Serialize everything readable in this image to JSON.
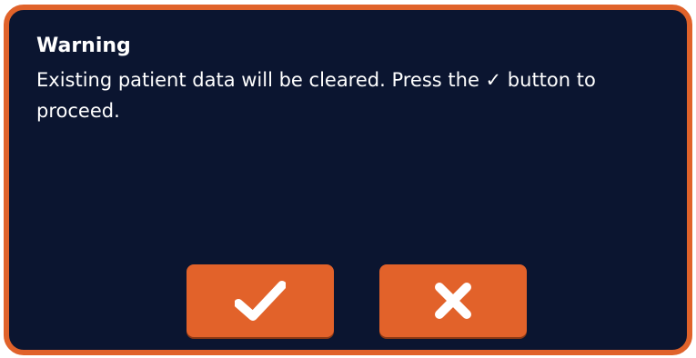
{
  "dialog": {
    "title": "Warning",
    "message": "Existing patient data will be cleared.  Press the ✓ button to proceed.",
    "confirm_icon": "checkmark-icon",
    "cancel_icon": "close-icon"
  },
  "colors": {
    "background": "#0b1530",
    "accent": "#e2622a",
    "text": "#ffffff"
  }
}
